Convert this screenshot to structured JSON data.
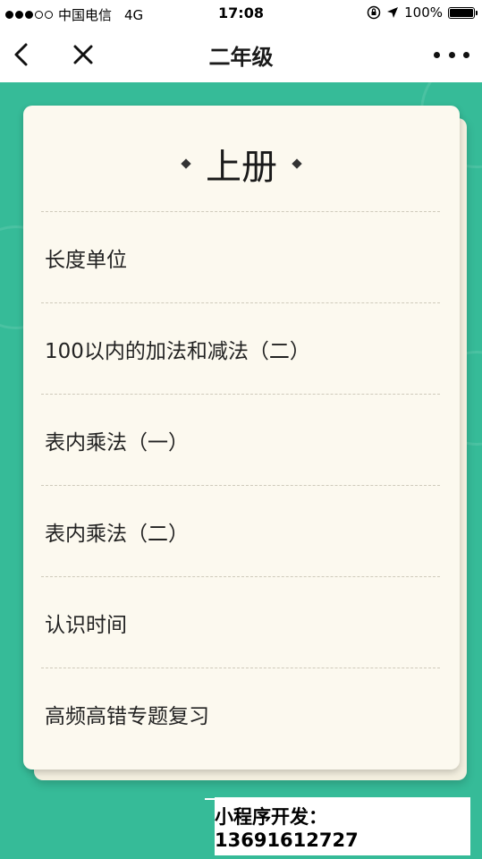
{
  "status_bar": {
    "carrier": "中国电信",
    "network": "4G",
    "time": "17:08",
    "battery": "100%"
  },
  "nav": {
    "title": "二年级",
    "back_icon": "chevron-left-icon",
    "close_icon": "close-icon",
    "more_icon": "more-dots-icon"
  },
  "card": {
    "title": "上册",
    "lessons": [
      "长度单位",
      "100以内的加法和减法（二）",
      "表内乘法（一）",
      "表内乘法（二）",
      "认识时间",
      "高频高错专题复习"
    ]
  },
  "watermark": "小程序开发：13691612727",
  "colors": {
    "background": "#36bb98",
    "card": "#fcf9ef"
  }
}
